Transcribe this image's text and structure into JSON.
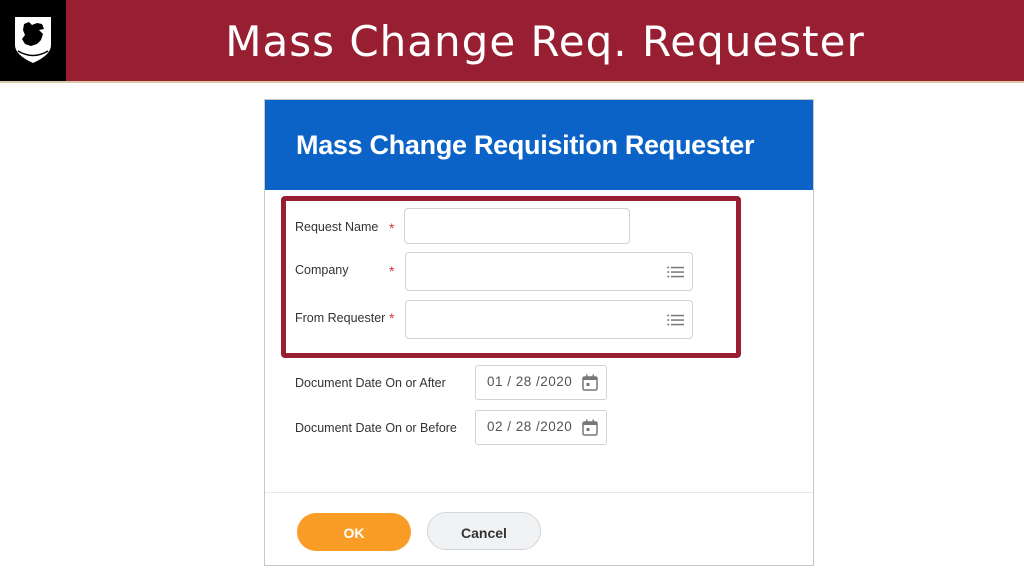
{
  "slide": {
    "title": "Mass Change Req. Requester",
    "brand_color": "#981e32",
    "logo": "wsu-cougar-shield-logo"
  },
  "dialog": {
    "title": "Mass Change Requisition Requester",
    "header_color": "#0b63c7",
    "required_fields": [
      {
        "label": "Request Name",
        "required": true,
        "value": "",
        "type": "text"
      },
      {
        "label": "Company",
        "required": true,
        "value": "",
        "type": "prompt",
        "icon": "list-icon"
      },
      {
        "label": "From Requester",
        "required": true,
        "value": "",
        "type": "prompt",
        "icon": "list-icon"
      }
    ],
    "date_fields": [
      {
        "label": "Document Date On or After",
        "value": "01 / 28 /2020",
        "icon": "calendar-icon"
      },
      {
        "label": "Document Date On or Before",
        "value": "02 / 28 /2020",
        "icon": "calendar-icon"
      }
    ],
    "required_marker": "*",
    "buttons": {
      "ok": "OK",
      "cancel": "Cancel",
      "ok_color": "#f99d27"
    }
  }
}
